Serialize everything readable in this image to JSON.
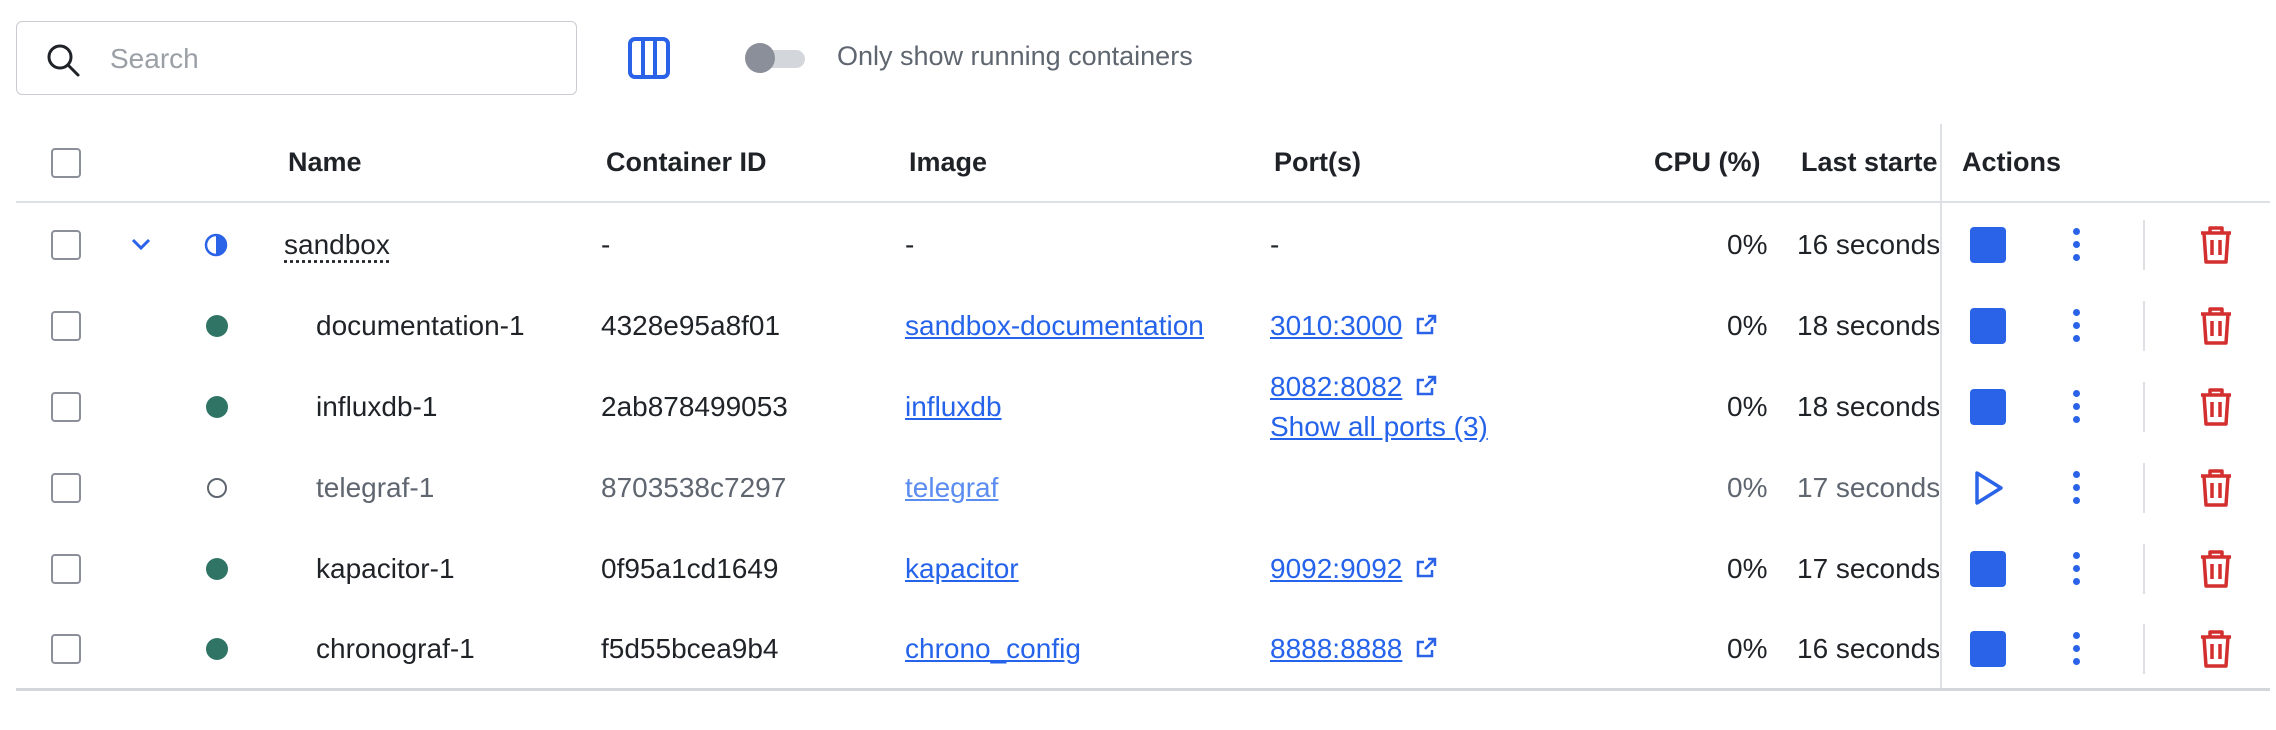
{
  "toolbar": {
    "search_placeholder": "Search",
    "columns_icon": "columns-icon",
    "toggle_label": "Only show running containers",
    "toggle_on": false
  },
  "columns": {
    "name": "Name",
    "container_id": "Container ID",
    "image": "Image",
    "ports": "Port(s)",
    "cpu": "CPU (%)",
    "last_started": "Last starte",
    "actions": "Actions"
  },
  "rows": [
    {
      "name": "sandbox",
      "container_id": "-",
      "image": "-",
      "port": "-",
      "cpu": "0%",
      "last_started": "16 seconds",
      "status": "partial",
      "group": true
    },
    {
      "name": "documentation-1",
      "container_id": "4328e95a8f01",
      "image": "sandbox-documentation",
      "port": "3010:3000",
      "cpu": "0%",
      "last_started": "18 seconds",
      "status": "running"
    },
    {
      "name": "influxdb-1",
      "container_id": "2ab878499053",
      "image": "influxdb",
      "port": "8082:8082",
      "show_all": "Show all ports (3)",
      "cpu": "0%",
      "last_started": "18 seconds",
      "status": "running"
    },
    {
      "name": "telegraf-1",
      "container_id": "8703538c7297",
      "image": "telegraf",
      "port": "",
      "cpu": "0%",
      "last_started": "17 seconds",
      "status": "stopped"
    },
    {
      "name": "kapacitor-1",
      "container_id": "0f95a1cd1649",
      "image": "kapacitor",
      "port": "9092:9092",
      "cpu": "0%",
      "last_started": "17 seconds",
      "status": "running"
    },
    {
      "name": "chronograf-1",
      "container_id": "f5d55bcea9b4",
      "image": "chrono_config",
      "port": "8888:8888",
      "cpu": "0%",
      "last_started": "16 seconds",
      "status": "running"
    }
  ],
  "colors": {
    "accent": "#2a63e8",
    "running": "#2f7465",
    "delete": "#d32f2f"
  }
}
